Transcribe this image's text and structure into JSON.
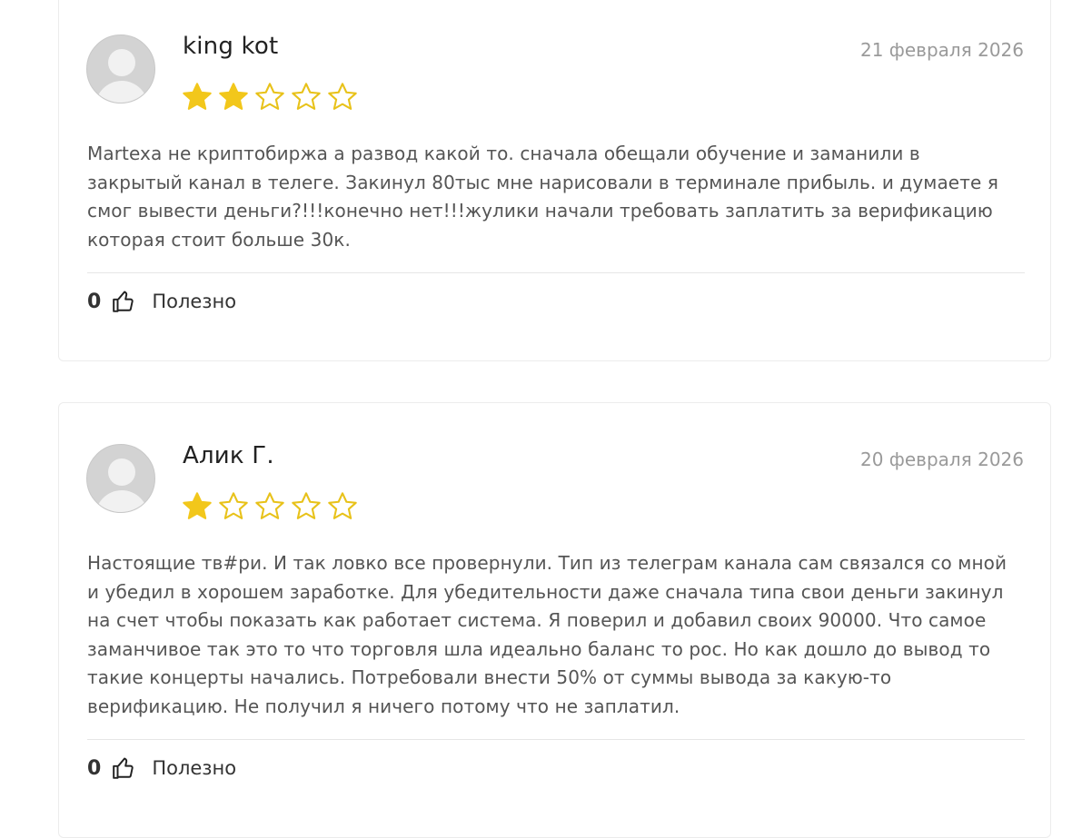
{
  "reviews": [
    {
      "author": "king kot",
      "date": "21 февраля 2026",
      "rating": 2,
      "max_rating": 5,
      "lines": [
        "Martexa не криптобиржа а развод какой то. сначала обещали обучение и заманили в",
        "закрытый канал в телеге. Закинул 80тыс мне нарисовали в терминале прибыль. и думаете я",
        "смог вывести деньги?!!!конечно нет!!!жулики начали требовать заплатить за верификацию",
        "которая стоит больше 30к."
      ],
      "likes": "0",
      "helpful_label": "Полезно"
    },
    {
      "author": "Алик Г.",
      "date": "20 февраля 2026",
      "rating": 1,
      "max_rating": 5,
      "lines": [
        "Настоящие тв#ри. И так ловко все провернули. Тип из телеграм канала сам связался со мной",
        "и убедил в хорошем заработке. Для убедительности даже сначала типа свои деньги закинул",
        "на счет чтобы показать как работает система. Я поверил и добавил своих 90000. Что самое",
        "заманчивое так это то что торговля шла идеально баланс то рос. Но как дошло до вывод то",
        "такие концерты начались. Потребовали внести 50% от суммы вывода за какую-то",
        "верификацию. Не получил я ничего потому что не заплатил."
      ],
      "likes": "0",
      "helpful_label": "Полезно"
    }
  ],
  "colors": {
    "star_filled": "#f2c71b",
    "star_outline": "#e8c21a",
    "text": "#555555",
    "date": "#9a9a9a"
  }
}
